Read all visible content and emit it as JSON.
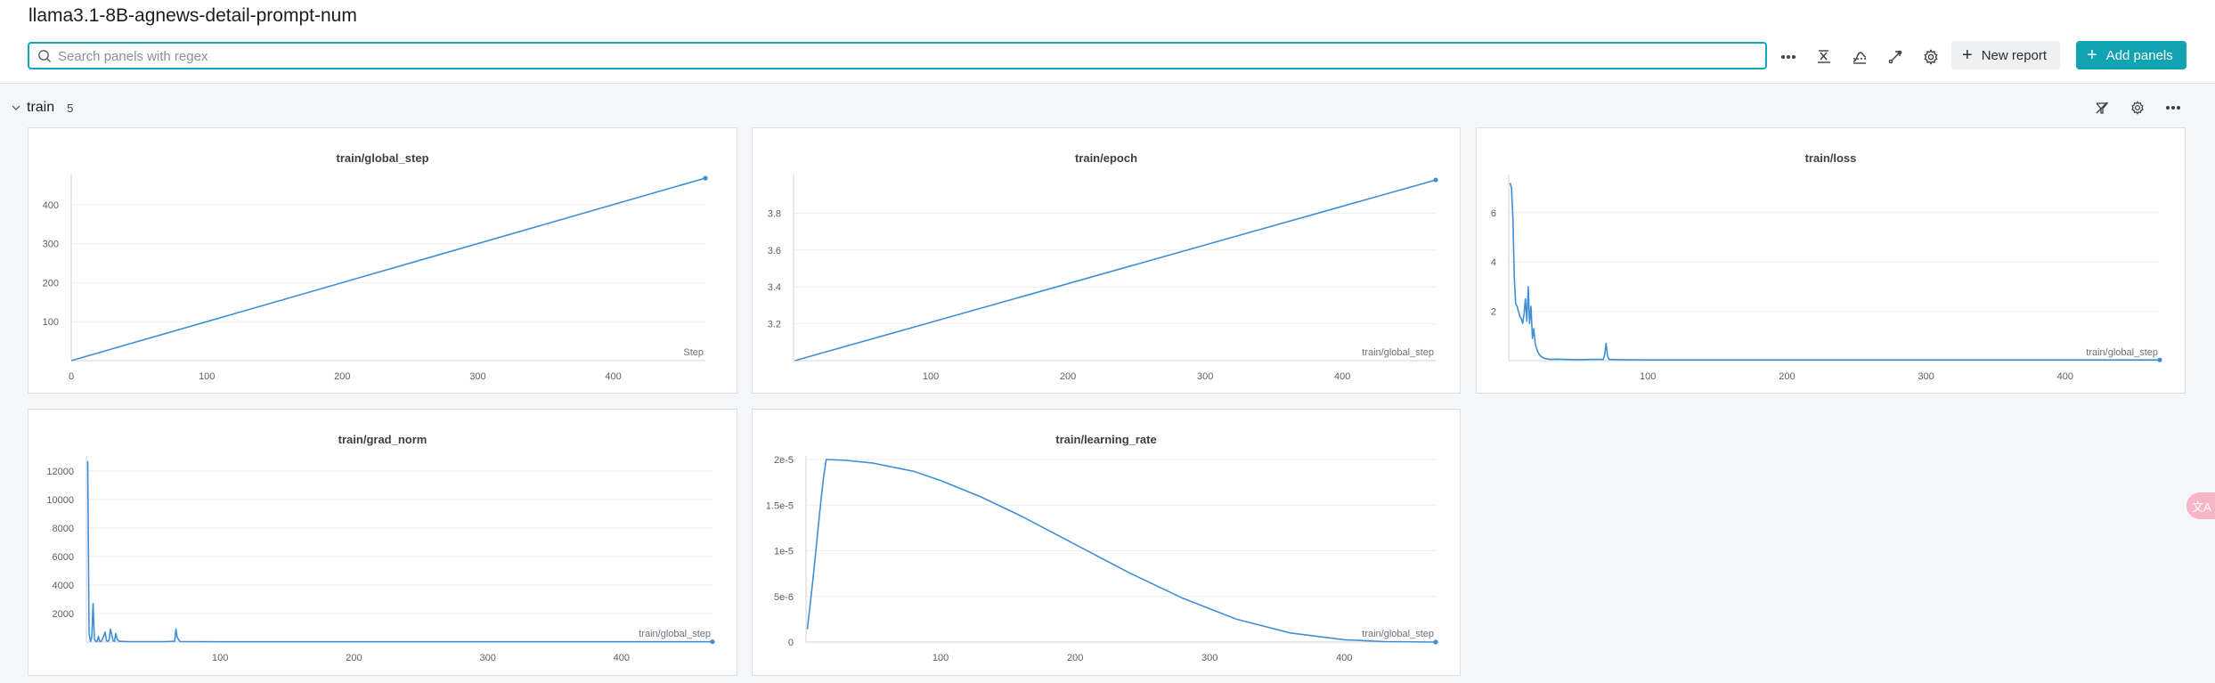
{
  "header": {
    "title": "llama3.1-8B-agnews-detail-prompt-num",
    "search_placeholder": "Search panels with regex",
    "new_report_label": "New report",
    "add_panels_label": "Add panels"
  },
  "section": {
    "name": "train",
    "count": "5"
  },
  "colors": {
    "accent": "#12a3b3",
    "series": "#3f8fd7"
  },
  "chart_data": [
    {
      "type": "line",
      "title": "train/global_step",
      "xlabel": "Step",
      "xlim": [
        0,
        468
      ],
      "ylim": [
        0,
        468
      ],
      "xticks": [
        0,
        100,
        200,
        300,
        400
      ],
      "yticks": [
        100,
        200,
        300,
        400
      ],
      "yticklabels": [
        "100",
        "200",
        "300",
        "400"
      ],
      "series": [
        {
          "x": [
            0,
            468
          ],
          "y": [
            0,
            468
          ]
        }
      ]
    },
    {
      "type": "line",
      "title": "train/epoch",
      "xlabel": "train/global_step",
      "xlim": [
        0,
        468
      ],
      "ylim": [
        3.0,
        3.99
      ],
      "xticks": [
        100,
        200,
        300,
        400
      ],
      "yticks": [
        3.2,
        3.4,
        3.6,
        3.8
      ],
      "yticklabels": [
        "3.2",
        "3.4",
        "3.6",
        "3.8"
      ],
      "series": [
        {
          "x": [
            1,
            468
          ],
          "y": [
            3.0,
            3.98
          ]
        }
      ]
    },
    {
      "type": "line",
      "title": "train/loss",
      "xlabel": "train/global_step",
      "xlim": [
        0,
        468
      ],
      "ylim": [
        0,
        7.4
      ],
      "xticks": [
        100,
        200,
        300,
        400
      ],
      "yticks": [
        2,
        4,
        6
      ],
      "yticklabels": [
        "2",
        "4",
        "6"
      ],
      "series": [
        {
          "x": [
            1,
            2,
            3,
            4,
            5,
            6,
            7,
            8,
            9,
            10,
            11,
            12,
            13,
            14,
            15,
            16,
            17,
            18,
            19,
            20,
            21,
            22,
            23,
            24,
            25,
            27,
            30,
            35,
            40,
            50,
            60,
            68,
            69,
            70,
            71,
            72,
            80,
            100,
            150,
            200,
            250,
            300,
            350,
            400,
            450,
            468
          ],
          "y": [
            7.2,
            7.0,
            5.8,
            3.4,
            2.3,
            2.2,
            2.0,
            1.8,
            1.7,
            1.5,
            1.9,
            2.5,
            1.6,
            3.0,
            1.5,
            2.2,
            0.9,
            1.3,
            0.7,
            0.5,
            0.35,
            0.25,
            0.18,
            0.15,
            0.1,
            0.08,
            0.05,
            0.06,
            0.05,
            0.04,
            0.05,
            0.05,
            0.25,
            0.7,
            0.2,
            0.05,
            0.04,
            0.03,
            0.03,
            0.03,
            0.03,
            0.03,
            0.03,
            0.03,
            0.03,
            0.03
          ]
        }
      ]
    },
    {
      "type": "line",
      "title": "train/grad_norm",
      "xlabel": "train/global_step",
      "xlim": [
        0,
        468
      ],
      "ylim": [
        0,
        12800
      ],
      "xticks": [
        100,
        200,
        300,
        400
      ],
      "yticks": [
        2000,
        4000,
        6000,
        8000,
        10000,
        12000
      ],
      "yticklabels": [
        "2000",
        "4000",
        "6000",
        "8000",
        "10000",
        "12000"
      ],
      "series": [
        {
          "x": [
            1,
            2,
            3,
            4,
            5,
            6,
            7,
            8,
            9,
            10,
            11,
            12,
            14,
            15,
            16,
            17,
            18,
            20,
            21,
            22,
            23,
            24,
            25,
            30,
            60,
            66,
            67,
            68,
            70,
            80,
            100,
            200,
            300,
            400,
            468
          ],
          "y": [
            12700,
            600,
            50,
            300,
            2700,
            200,
            60,
            30,
            400,
            50,
            30,
            200,
            700,
            100,
            50,
            150,
            900,
            100,
            50,
            600,
            200,
            80,
            50,
            40,
            30,
            60,
            900,
            300,
            40,
            30,
            20,
            20,
            20,
            20,
            20
          ]
        }
      ]
    },
    {
      "type": "line",
      "title": "train/learning_rate",
      "xlabel": "train/global_step",
      "xlim": [
        0,
        468
      ],
      "ylim": [
        0,
        2e-05
      ],
      "xticks": [
        100,
        200,
        300,
        400
      ],
      "yticks": [
        0,
        5e-06,
        1e-05,
        1.5e-05,
        2e-05
      ],
      "yticklabels": [
        "0",
        "5e-6",
        "1e-5",
        "1.5e-5",
        "2e-5"
      ],
      "series": [
        {
          "x": [
            1,
            3,
            5,
            8,
            10,
            13,
            15,
            30,
            50,
            80,
            100,
            130,
            160,
            200,
            240,
            280,
            320,
            360,
            400,
            430,
            468
          ],
          "y": [
            1.4e-06,
            4e-06,
            6.7e-06,
            1.1e-05,
            1.4e-05,
            1.8e-05,
            2e-05,
            1.99e-05,
            1.96e-05,
            1.87e-05,
            1.77e-05,
            1.59e-05,
            1.38e-05,
            1.07e-05,
            7.6e-06,
            4.8e-06,
            2.5e-06,
            1e-06,
            2.5e-07,
            5e-08,
            0.0
          ]
        }
      ]
    }
  ]
}
